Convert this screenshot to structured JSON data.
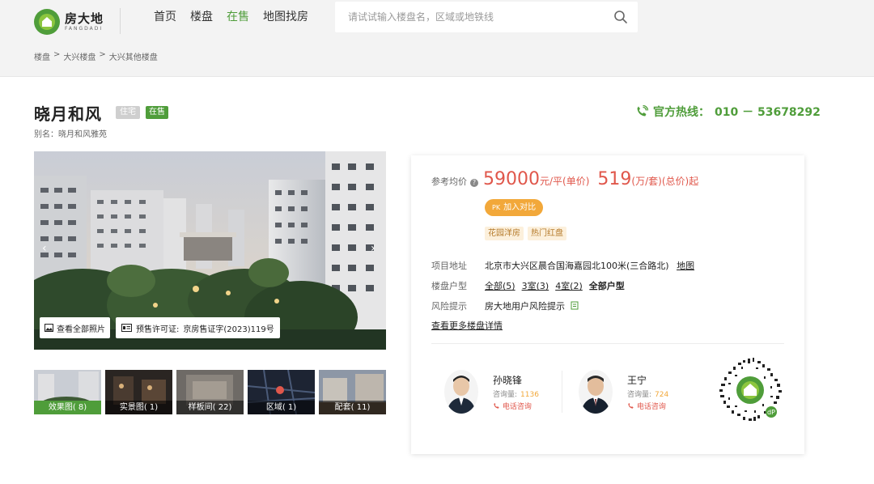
{
  "header": {
    "logo_cn": "房大地",
    "logo_en": "FANGDADI",
    "nav": [
      {
        "label": "首页",
        "active": false
      },
      {
        "label": "楼盘",
        "active": false
      },
      {
        "label": "在售",
        "active": true
      },
      {
        "label": "地图找房",
        "active": false
      }
    ],
    "search_placeholder": "请试试输入楼盘名，区域或地铁线"
  },
  "breadcrumb": [
    "楼盘",
    ">",
    "大兴楼盘",
    ">",
    "大兴其他楼盘"
  ],
  "project": {
    "name": "晓月和风",
    "type_tag": "住宅",
    "status_tag": "在售",
    "alias": "别名：晓月和风雅苑"
  },
  "hotline": {
    "label": "官方热线：",
    "number": "010 － 53678292"
  },
  "gallery": {
    "view_all_label": "查看全部照片",
    "license_label": "预售许可证:",
    "license_value": "京房售证字(2023)119号",
    "prev_arrow": "‹",
    "next_arrow": "›",
    "thumbs": [
      {
        "label": "效果图( 8)",
        "active": true
      },
      {
        "label": "实景图( 1)",
        "active": false
      },
      {
        "label": "样板间( 22)",
        "active": false
      },
      {
        "label": "区域( 1)",
        "active": false
      },
      {
        "label": "配套( 11)",
        "active": false
      }
    ]
  },
  "price": {
    "label": "参考均价",
    "unit_price": "59000",
    "unit_price_suffix": "元/平(单价)",
    "total_price": "519",
    "total_price_suffix": "(万/套)(总价)起",
    "compare_prefix": "PK",
    "compare_label": "加入对比"
  },
  "feature_tags": [
    "花园洋房",
    "热门红盘"
  ],
  "info": {
    "address_label": "项目地址",
    "address": "北京市大兴区晨合国海嘉园北100米(三合路北)",
    "map_link": "地图",
    "layout_label": "楼盘户型",
    "layouts": [
      "全部(5)",
      "3室(3)",
      "4室(2)"
    ],
    "layouts_all": "全部户型",
    "risk_label": "风险提示",
    "risk_text": "房大地用户风险提示",
    "more_link": "查看更多楼盘详情"
  },
  "agents": [
    {
      "name": "孙晓锋",
      "count_label": "咨询量:",
      "count": "1136",
      "call_label": "电话咨询"
    },
    {
      "name": "王宁",
      "count_label": "咨询量:",
      "count": "724",
      "call_label": "电话咨询"
    }
  ],
  "colors": {
    "brand_green": "#4f9d3a",
    "price_red": "#e0574b",
    "accent_orange": "#f2a83a"
  }
}
